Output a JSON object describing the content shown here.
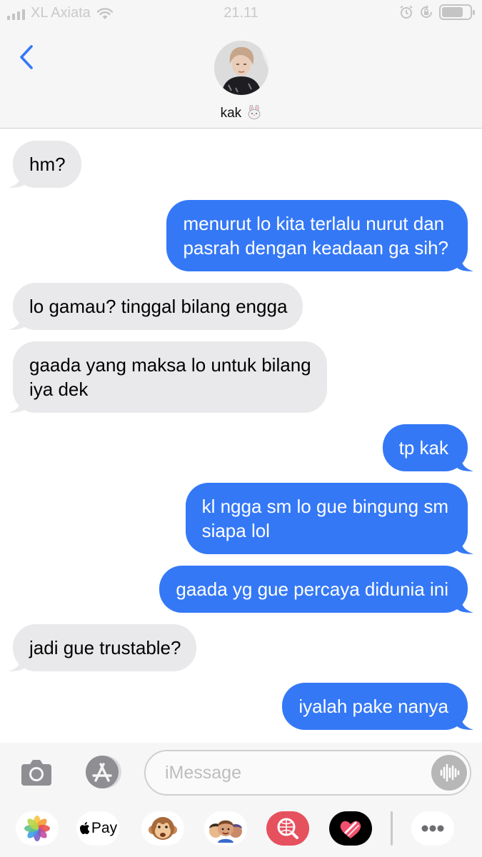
{
  "status_bar": {
    "carrier": "XL Axiata",
    "time": "21.11"
  },
  "header": {
    "contact_name": "kak",
    "contact_emoji": "rabbit-face-icon"
  },
  "messages": [
    {
      "direction": "incoming",
      "lines": [
        "hm?"
      ]
    },
    {
      "direction": "outgoing",
      "lines": [
        "menurut lo kita terlalu nurut dan",
        "pasrah dengan keadaan ga sih?"
      ]
    },
    {
      "direction": "incoming",
      "lines": [
        "lo gamau? tinggal bilang engga"
      ]
    },
    {
      "direction": "incoming",
      "lines": [
        "gaada yang maksa lo untuk bilang",
        "iya dek"
      ]
    },
    {
      "direction": "outgoing",
      "lines": [
        "tp kak"
      ]
    },
    {
      "direction": "outgoing",
      "lines": [
        "kl ngga sm lo gue bingung sm",
        "siapa lol"
      ]
    },
    {
      "direction": "outgoing",
      "lines": [
        "gaada yg gue percaya didunia ini"
      ]
    },
    {
      "direction": "incoming",
      "lines": [
        "jadi gue trustable?"
      ]
    },
    {
      "direction": "outgoing",
      "lines": [
        "iyalah pake nanya"
      ]
    }
  ],
  "compose": {
    "placeholder": "iMessage",
    "value": ""
  },
  "app_drawer": {
    "apple_pay_label": "Pay",
    "apps": [
      "photos-icon",
      "apple-pay-icon",
      "monkey-animoji-icon",
      "memoji-icon",
      "web-search-icon",
      "digital-touch-icon",
      "more-apps-icon"
    ]
  },
  "colors": {
    "outgoing_bubble": "#3478f6",
    "incoming_bubble": "#e9e9eb",
    "accent": "#3478f6"
  }
}
